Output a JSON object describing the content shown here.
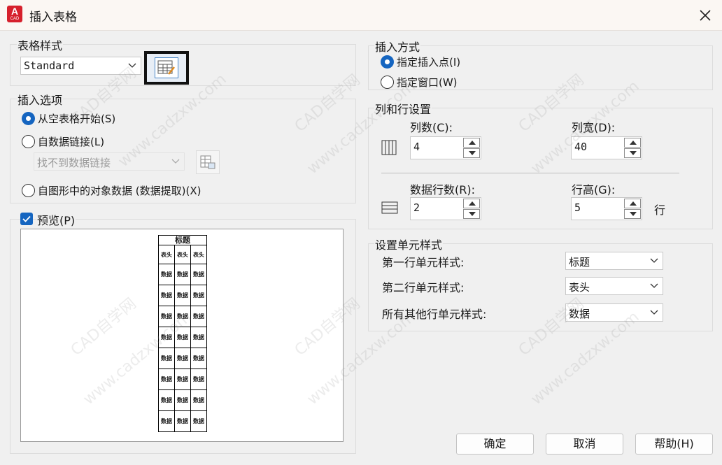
{
  "window": {
    "title": "插入表格",
    "app_icon_letter": "A",
    "app_icon_sub": "CAD"
  },
  "table_style": {
    "legend": "表格样式",
    "selected": "Standard"
  },
  "insert_options": {
    "legend": "插入选项",
    "option_empty": "从空表格开始(S)",
    "option_datalink": "自数据链接(L)",
    "datalink_value": "找不到数据链接",
    "option_object": "自图形中的对象数据 (数据提取)(X)",
    "selected": "option_empty"
  },
  "preview": {
    "label": "预览(P)",
    "checked": true,
    "table": {
      "title": "标题",
      "header": [
        "表头",
        "表头",
        "表头"
      ],
      "cell": "数据",
      "data_rows": 8
    }
  },
  "insert_method": {
    "legend": "插入方式",
    "option_point": "指定插入点(I)",
    "option_window": "指定窗口(W)",
    "selected": "option_point"
  },
  "cols_rows": {
    "legend": "列和行设置",
    "columns_label": "列数(C):",
    "columns_value": "4",
    "col_width_label": "列宽(D):",
    "col_width_value": "40",
    "data_rows_label": "数据行数(R):",
    "data_rows_value": "2",
    "row_height_label": "行高(G):",
    "row_height_value": "5",
    "row_height_unit": "行"
  },
  "cell_styles": {
    "legend": "设置单元样式",
    "first_row_label": "第一行单元样式:",
    "first_row_value": "标题",
    "second_row_label": "第二行单元样式:",
    "second_row_value": "表头",
    "other_rows_label": "所有其他行单元样式:",
    "other_rows_value": "数据"
  },
  "buttons": {
    "ok": "确定",
    "cancel": "取消",
    "help": "帮助(H)"
  },
  "watermarks": [
    "CAD自学网",
    "www.cadzxw.com"
  ],
  "colors": {
    "accent": "#1565c0",
    "app_icon": "#d6202c"
  }
}
